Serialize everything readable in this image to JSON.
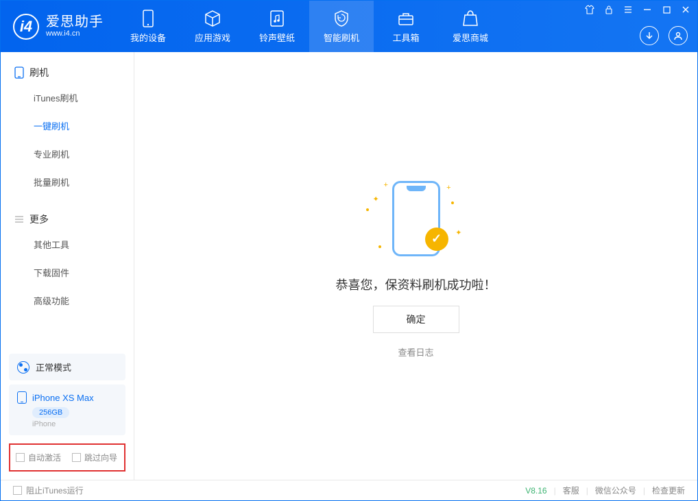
{
  "app": {
    "name": "爱思助手",
    "url": "www.i4.cn"
  },
  "topTabs": [
    {
      "label": "我的设备"
    },
    {
      "label": "应用游戏"
    },
    {
      "label": "铃声壁纸"
    },
    {
      "label": "智能刷机"
    },
    {
      "label": "工具箱"
    },
    {
      "label": "爱思商城"
    }
  ],
  "sidebar": {
    "section1": {
      "title": "刷机",
      "items": [
        "iTunes刷机",
        "一键刷机",
        "专业刷机",
        "批量刷机"
      ],
      "activeIndex": 1
    },
    "section2": {
      "title": "更多",
      "items": [
        "其他工具",
        "下载固件",
        "高级功能"
      ]
    }
  },
  "mode": {
    "label": "正常模式"
  },
  "device": {
    "name": "iPhone XS Max",
    "storage": "256GB",
    "type": "iPhone"
  },
  "checkboxes": {
    "auto_activate": "自动激活",
    "skip_guide": "跳过向导"
  },
  "main": {
    "success_text": "恭喜您，保资料刷机成功啦！",
    "ok_button": "确定",
    "view_log": "查看日志"
  },
  "footer": {
    "block_itunes": "阻止iTunes运行",
    "version": "V8.16",
    "support": "客服",
    "wechat": "微信公众号",
    "check_update": "检查更新"
  }
}
